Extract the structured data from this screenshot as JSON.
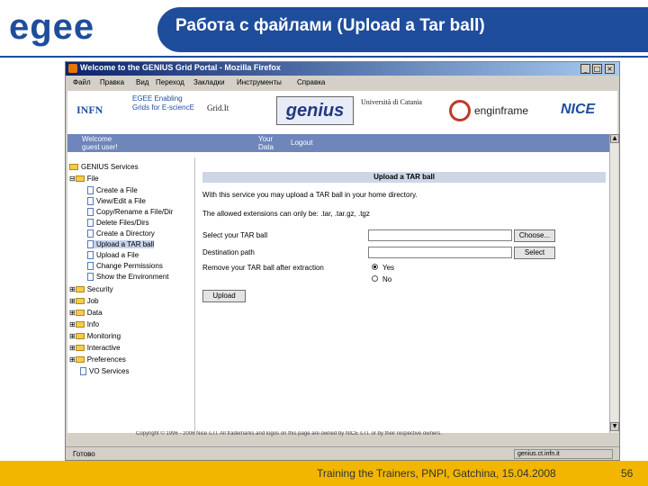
{
  "slide": {
    "logo": "egee",
    "title": "Работа с файлами (Upload a Tar ball)",
    "footer": "Training the Trainers, PNPI, Gatchina, 15.04.2008",
    "page_number": "56",
    "colors": {
      "header_blue": "#1e4d9c",
      "footer_gold": "#f2b600"
    }
  },
  "browser": {
    "window_title": "Welcome to the GENIUS Grid Portal - Mozilla Firefox",
    "menu": [
      "Файл",
      "Правка",
      "Вид",
      "Переход",
      "Закладки",
      "Инструменты",
      "Справка"
    ],
    "logos": [
      "INFN",
      "EGEE Enabling Grids for E-sciencE",
      "Grid.It",
      "genius",
      "Università di Catania",
      "enginframe",
      "NICE"
    ],
    "nav": {
      "welcome": "Welcome",
      "username": "guest user!",
      "your_data": "Your Data",
      "logout": "Logout"
    },
    "tree": {
      "root": "GENIUS Services",
      "file_folder": "File",
      "file_children": [
        "Create a File",
        "View/Edit a File",
        "Copy/Rename a File/Dir",
        "Delete Files/Dirs",
        "Create a Directory",
        "Upload a TAR ball",
        "Upload a File",
        "Change Permissions",
        "Show the Environment"
      ],
      "selected": "Upload a TAR ball",
      "other_folders": [
        "Security",
        "Job",
        "Data",
        "Info",
        "Monitoring",
        "Interactive",
        "Preferences"
      ],
      "last_item": "VO Services"
    },
    "form": {
      "header": "Upload a TAR ball",
      "intro": "With this service you may upload a TAR ball in your home directory.",
      "extensions": "The allowed extensions can only be: .tar, .tar.gz, .tgz",
      "select_label": "Select your TAR ball",
      "dest_label": "Destination path",
      "remove_label": "Remove your TAR ball after extraction",
      "choose_btn": "Choose...",
      "select_btn": "Select",
      "radio_yes": "Yes",
      "radio_no": "No",
      "upload_btn": "Upload"
    },
    "copyright": "Copyright © 1996 - 2006 Nice s.r.l. All trademarks and logos on this page are owned by NICE s.r.l. or by their respective owners.",
    "status": "Готово",
    "status_right": "genius.ct.infn.it"
  }
}
